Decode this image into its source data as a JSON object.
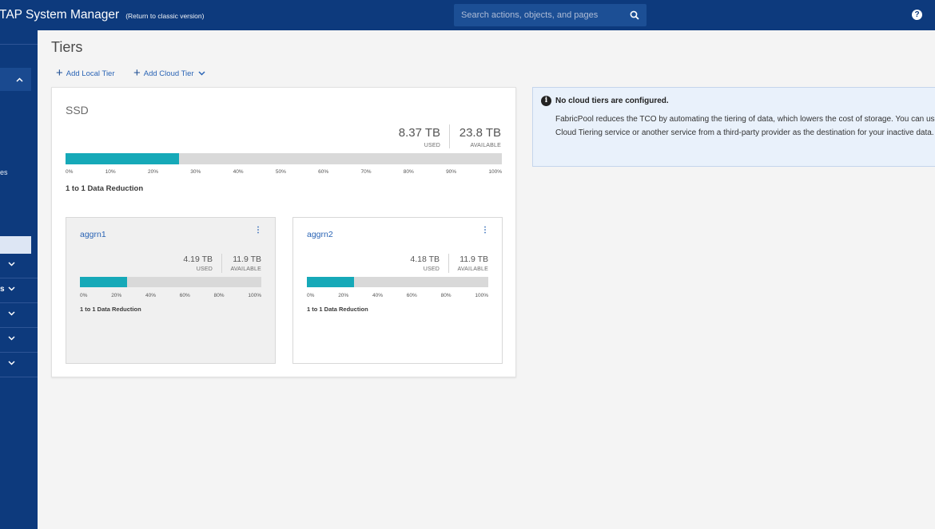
{
  "header": {
    "app_name": "TAP System Manager",
    "classic_link": "(Return to classic version)",
    "search_placeholder": "Search actions, objects, and pages",
    "help_label": "?"
  },
  "sidebar": {
    "partial_labels": [
      "es",
      "s"
    ]
  },
  "page": {
    "title": "Tiers",
    "actions": {
      "add_local_tier": "Add Local Tier",
      "add_cloud_tier": "Add Cloud Tier"
    }
  },
  "tier": {
    "name": "SSD",
    "used_value": "8.37 TB",
    "used_label": "USED",
    "available_value": "23.8 TB",
    "available_label": "AVAILABLE",
    "used_fraction": 0.26,
    "ticks": [
      "0%",
      "10%",
      "20%",
      "30%",
      "40%",
      "50%",
      "60%",
      "70%",
      "80%",
      "90%",
      "100%"
    ],
    "reduction": "1 to 1 Data Reduction",
    "aggregates": [
      {
        "name": "aggrn1",
        "used_value": "4.19 TB",
        "used_label": "USED",
        "available_value": "11.9 TB",
        "available_label": "AVAILABLE",
        "used_fraction": 0.26,
        "ticks": [
          "0%",
          "20%",
          "40%",
          "60%",
          "80%",
          "100%"
        ],
        "reduction": "1 to 1 Data Reduction",
        "menu_glyph": "⋮"
      },
      {
        "name": "aggrn2",
        "used_value": "4.18 TB",
        "used_label": "USED",
        "available_value": "11.9 TB",
        "available_label": "AVAILABLE",
        "used_fraction": 0.26,
        "ticks": [
          "0%",
          "20%",
          "40%",
          "60%",
          "80%",
          "100%"
        ],
        "reduction": "1 to 1 Data Reduction",
        "menu_glyph": "⋮"
      }
    ]
  },
  "info_panel": {
    "icon_glyph": "i",
    "title": "No cloud tiers are configured.",
    "body": "FabricPool reduces the TCO by automating the tiering of data, which lowers the cost of storage. You can use the Cloud Tiering service or another service from a third-party provider as the destination for your inactive data."
  },
  "colors": {
    "header_bg": "#0d3a7d",
    "bar_fill": "#16a9b8",
    "bar_track": "#d9d9d9",
    "link": "#2a64b5",
    "info_bg": "#e9f1fb"
  }
}
